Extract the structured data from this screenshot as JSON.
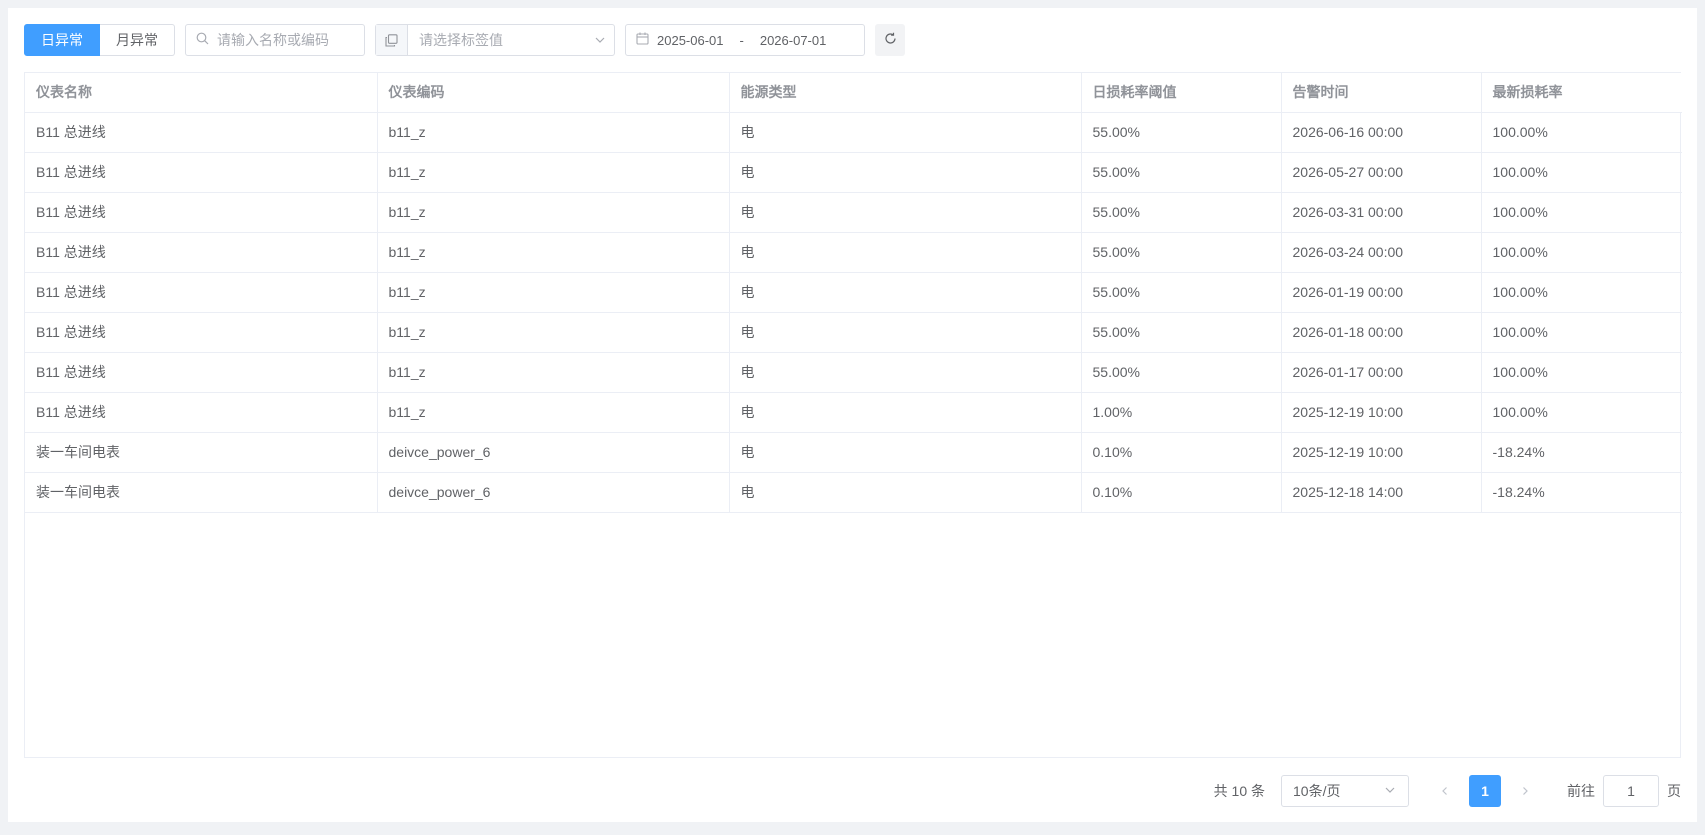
{
  "toolbar": {
    "tabs": [
      {
        "label": "日异常",
        "active": true
      },
      {
        "label": "月异常",
        "active": false
      }
    ],
    "search_placeholder": "请输入名称或编码",
    "tag_select_placeholder": "请选择标签值",
    "date_start": "2025-06-01",
    "date_separator": "-",
    "date_end": "2026-07-01"
  },
  "table": {
    "columns": [
      "仪表名称",
      "仪表编码",
      "能源类型",
      "日损耗率阈值",
      "告警时间",
      "最新损耗率"
    ],
    "rows": [
      [
        "B11 总进线",
        "b11_z",
        "电",
        "55.00%",
        "2026-06-16 00:00",
        "100.00%"
      ],
      [
        "B11 总进线",
        "b11_z",
        "电",
        "55.00%",
        "2026-05-27 00:00",
        "100.00%"
      ],
      [
        "B11 总进线",
        "b11_z",
        "电",
        "55.00%",
        "2026-03-31 00:00",
        "100.00%"
      ],
      [
        "B11 总进线",
        "b11_z",
        "电",
        "55.00%",
        "2026-03-24 00:00",
        "100.00%"
      ],
      [
        "B11 总进线",
        "b11_z",
        "电",
        "55.00%",
        "2026-01-19 00:00",
        "100.00%"
      ],
      [
        "B11 总进线",
        "b11_z",
        "电",
        "55.00%",
        "2026-01-18 00:00",
        "100.00%"
      ],
      [
        "B11 总进线",
        "b11_z",
        "电",
        "55.00%",
        "2026-01-17 00:00",
        "100.00%"
      ],
      [
        "B11 总进线",
        "b11_z",
        "电",
        "1.00%",
        "2025-12-19 10:00",
        "100.00%"
      ],
      [
        "装一车间电表",
        "deivce_power_6",
        "电",
        "0.10%",
        "2025-12-19 10:00",
        "-18.24%"
      ],
      [
        "装一车间电表",
        "deivce_power_6",
        "电",
        "0.10%",
        "2025-12-18 14:00",
        "-18.24%"
      ]
    ]
  },
  "pagination": {
    "total_text": "共 10 条",
    "page_size": "10条/页",
    "current_page": "1",
    "goto_label": "前往",
    "goto_value": "1",
    "page_suffix": "页"
  },
  "colors": {
    "primary": "#409eff",
    "page_bg": "#f0f2f5",
    "border": "#ebeef5"
  }
}
